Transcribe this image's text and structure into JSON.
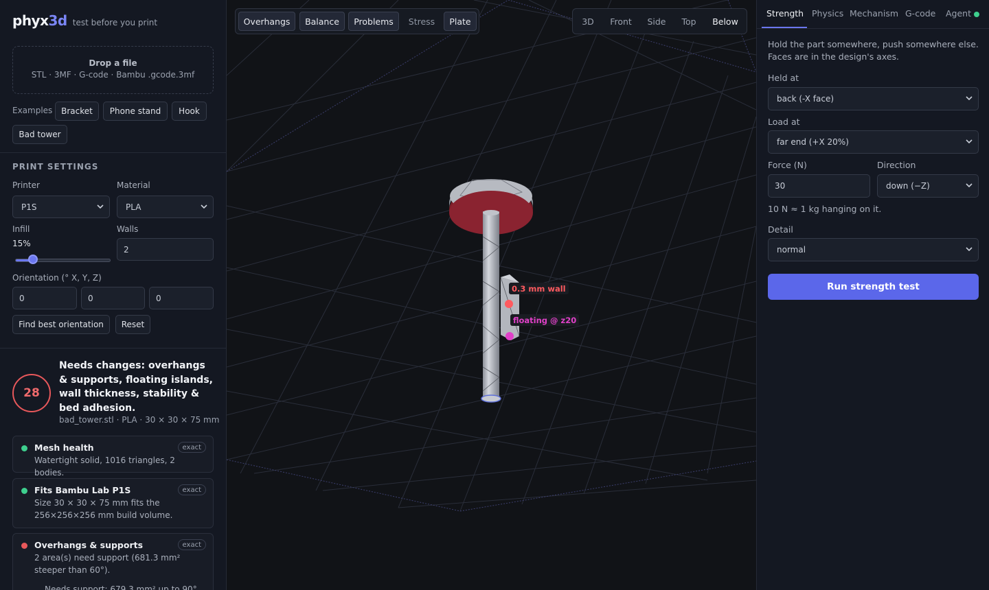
{
  "app": {
    "logo_main": "phyx",
    "logo_accent": "3d",
    "tagline": "test before you print"
  },
  "dropzone": {
    "title": "Drop a file",
    "formats": "STL · 3MF · G-code · Bambu .gcode.3mf"
  },
  "examples": {
    "label": "Examples",
    "items": [
      "Bracket",
      "Phone stand",
      "Hook",
      "Bad tower"
    ]
  },
  "print_settings": {
    "title": "PRINT SETTINGS",
    "printer_label": "Printer",
    "printer_value": "P1S",
    "material_label": "Material",
    "material_value": "PLA",
    "infill_label": "Infill",
    "infill_value": "15%",
    "infill_fraction": 0.15,
    "walls_label": "Walls",
    "walls_value": "2",
    "orientation_label": "Orientation (° X, Y, Z)",
    "orientation_x": "0",
    "orientation_y": "0",
    "orientation_z": "0",
    "find_best_label": "Find best orientation",
    "reset_label": "Reset"
  },
  "result": {
    "score": "28",
    "verdict": "Needs changes: overhangs & supports, floating islands, wall thickness, stability & bed adhesion.",
    "file_summary": "bad_tower.stl · PLA · 30 × 30 × 75 mm"
  },
  "checks": [
    {
      "title": "Mesh health",
      "badge": "exact",
      "status_color": "#3ecf8e",
      "body": "Watertight solid, 1016 triangles, 2 bodies."
    },
    {
      "title": "Fits Bambu Lab P1S",
      "badge": "exact",
      "status_color": "#3ecf8e",
      "body": "Size 30 × 30 × 75 mm fits the 256×256×256 mm build volume."
    },
    {
      "title": "Overhangs & supports",
      "badge": "exact",
      "status_color": "#e8585b",
      "body": "2 area(s) need support (681.3 mm² steeper than 60°)."
    }
  ],
  "checks_more": "Needs support: 679.3 mm² up to 90°",
  "viewport": {
    "modes": [
      "Overhangs",
      "Balance",
      "Problems",
      "Stress",
      "Plate"
    ],
    "views": [
      "3D",
      "Front",
      "Side",
      "Top",
      "Below"
    ],
    "callout_wall": "0.3 mm wall",
    "callout_floating": "floating @ z20",
    "wall_color": "#ff5a5f",
    "floating_color": "#e040c8"
  },
  "right_panel": {
    "tabs": [
      "Strength",
      "Physics",
      "Mechanism",
      "G-code",
      "Agent"
    ],
    "intro": "Hold the part somewhere, push somewhere else. Faces are in the design's axes.",
    "held_label": "Held at",
    "held_value": "back (-X face)",
    "load_label": "Load at",
    "load_value": "far end (+X 20%)",
    "force_label": "Force (N)",
    "force_value": "30",
    "direction_label": "Direction",
    "direction_value": "down (−Z)",
    "force_hint": "10 N ≈ 1 kg hanging on it.",
    "detail_label": "Detail",
    "detail_value": "normal",
    "run_label": "Run strength test",
    "accent_color": "#5b67ea"
  }
}
